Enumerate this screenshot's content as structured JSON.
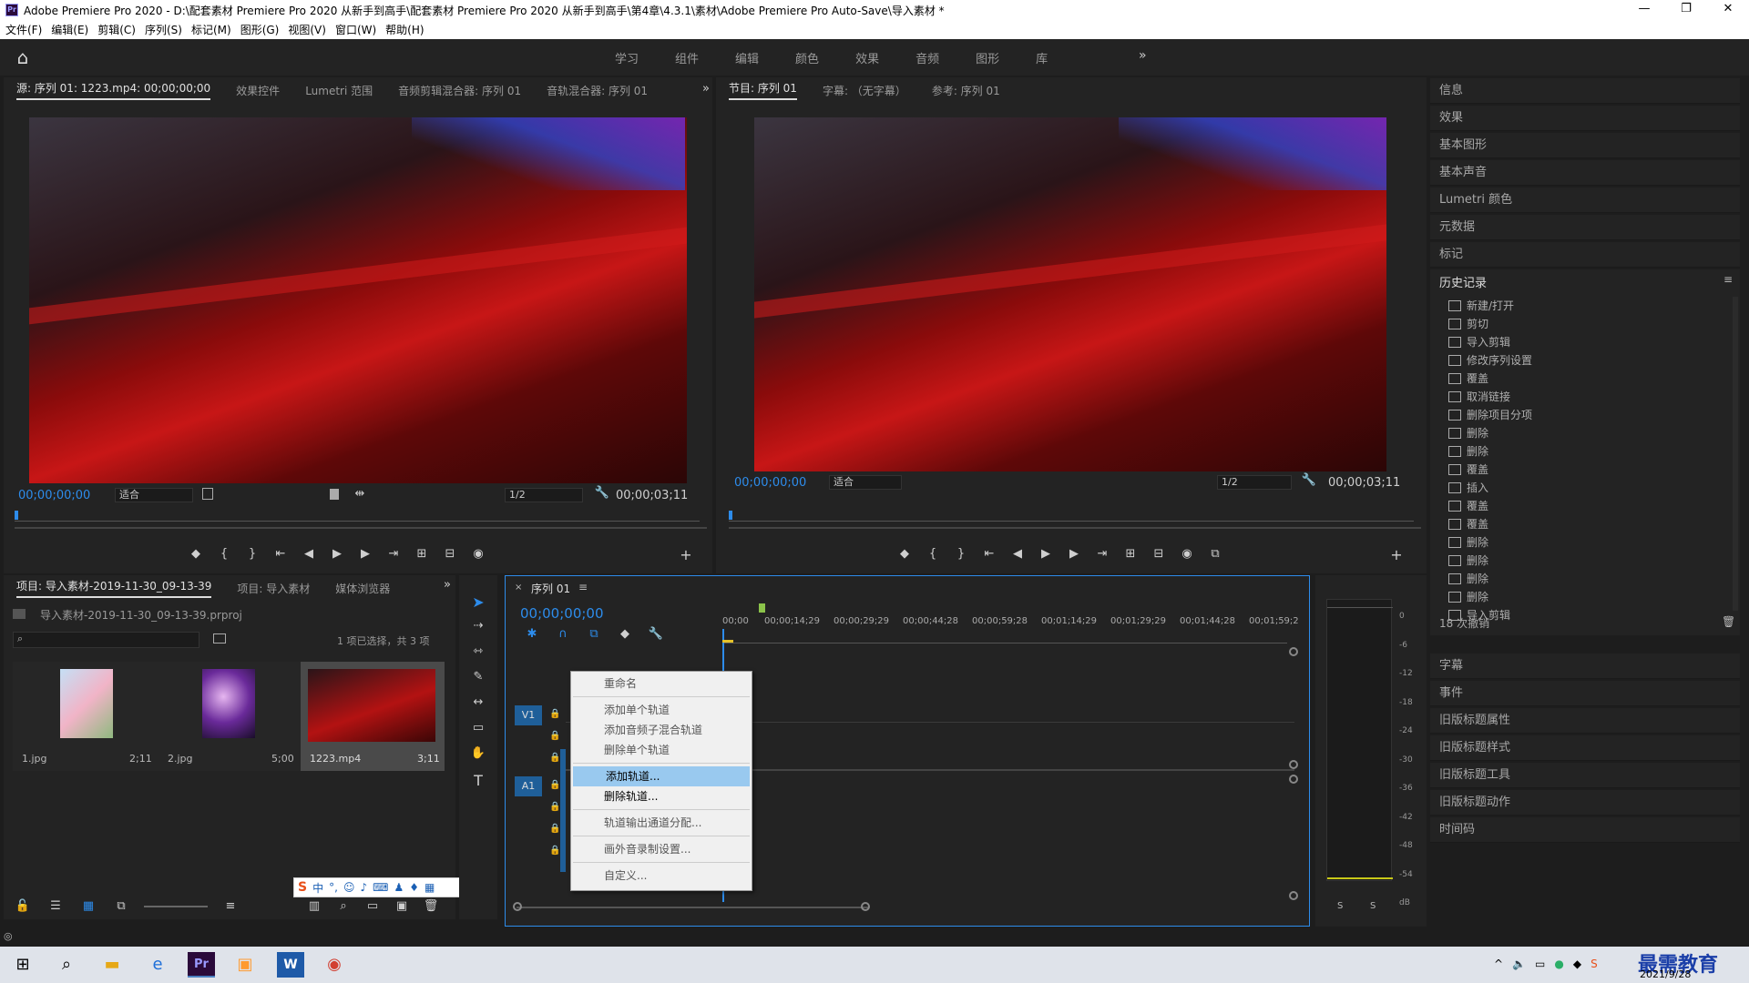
{
  "window": {
    "title": "Adobe Premiere Pro 2020 - D:\\配套素材 Premiere Pro 2020 从新手到高手\\配套素材 Premiere Pro 2020 从新手到高手\\第4章\\4.3.1\\素材\\Adobe Premiere Pro Auto-Save\\导入素材 *",
    "logo": "Pr",
    "minimize": "—",
    "restore": "❐",
    "close": "✕"
  },
  "menu": [
    "文件(F)",
    "编辑(E)",
    "剪辑(C)",
    "序列(S)",
    "标记(M)",
    "图形(G)",
    "视图(V)",
    "窗口(W)",
    "帮助(H)"
  ],
  "workspace_tabs": [
    "学习",
    "组件",
    "编辑",
    "颜色",
    "效果",
    "音频",
    "图形",
    "库"
  ],
  "workspace_more": "»",
  "source_panel": {
    "tabs": [
      "源: 序列 01: 1223.mp4: 00;00;00;00",
      "效果控件",
      "Lumetri 范围",
      "音频剪辑混合器: 序列 01",
      "音轨混合器: 序列 01"
    ],
    "timecode": "00;00;00;00",
    "fit": "适合",
    "resolution": "1/2",
    "duration": "00;00;03;11"
  },
  "program_panel": {
    "tabs": [
      "节目: 序列 01",
      "字幕: （无字幕）",
      "参考: 序列 01"
    ],
    "timecode": "00;00;00;00",
    "fit": "适合",
    "resolution": "1/2",
    "duration": "00;00;03;11"
  },
  "project_panel": {
    "tabs": [
      "项目: 导入素材-2019-11-30_09-13-39",
      "项目: 导入素材",
      "媒体浏览器"
    ],
    "file": "导入素材-2019-11-30_09-13-39.prproj",
    "selection": "1 项已选择，共 3 项",
    "items": [
      {
        "name": "1.jpg",
        "duration": "2;11"
      },
      {
        "name": "2.jpg",
        "duration": "5;00"
      },
      {
        "name": "1223.mp4",
        "duration": "3;11"
      }
    ]
  },
  "timeline": {
    "tab": "序列 01",
    "timecode": "00;00;00;00",
    "ruler": [
      "00;00",
      "00;00;14;29",
      "00;00;29;29",
      "00;00;44;28",
      "00;00;59;28",
      "00;01;14;29",
      "00;01;29;29",
      "00;01;44;28",
      "00;01;59;2"
    ],
    "tracks": {
      "v1": "V1",
      "a1": "A1"
    }
  },
  "context_menu": {
    "rename": "重命名",
    "add_single": "添加单个轨道",
    "add_submix": "添加音频子混合轨道",
    "delete_single": "删除单个轨道",
    "add_tracks": "添加轨道...",
    "delete_tracks": "删除轨道...",
    "track_output": "轨道输出通道分配...",
    "voiceover": "画外音录制设置...",
    "customize": "自定义..."
  },
  "meter": {
    "scale": [
      "0",
      "-6",
      "-12",
      "-18",
      "-24",
      "-30",
      "-36",
      "-42",
      "-48",
      "-54",
      "dB"
    ],
    "solo_left": "S",
    "solo_right": "S"
  },
  "right_panel": {
    "top_items": [
      "信息",
      "效果",
      "基本图形",
      "基本声音",
      "Lumetri 颜色",
      "元数据",
      "标记"
    ],
    "history_title": "历史记录",
    "history": [
      "新建/打开",
      "剪切",
      "导入剪辑",
      "修改序列设置",
      "覆盖",
      "取消链接",
      "删除项目分项",
      "删除",
      "删除",
      "覆盖",
      "插入",
      "覆盖",
      "覆盖",
      "删除",
      "删除",
      "删除",
      "删除",
      "导入剪辑"
    ],
    "undo_count": "18 次撤销",
    "bottom_items": [
      "字幕",
      "事件",
      "旧版标题属性",
      "旧版标题样式",
      "旧版标题工具",
      "旧版标题动作",
      "时间码"
    ]
  },
  "ime_bar": {
    "label": "中"
  },
  "taskbar": {
    "date": "2021/9/28",
    "watermark": "最需教育"
  },
  "colors": {
    "accent": "#2d8ceb",
    "highlight": "#99c9ef"
  }
}
